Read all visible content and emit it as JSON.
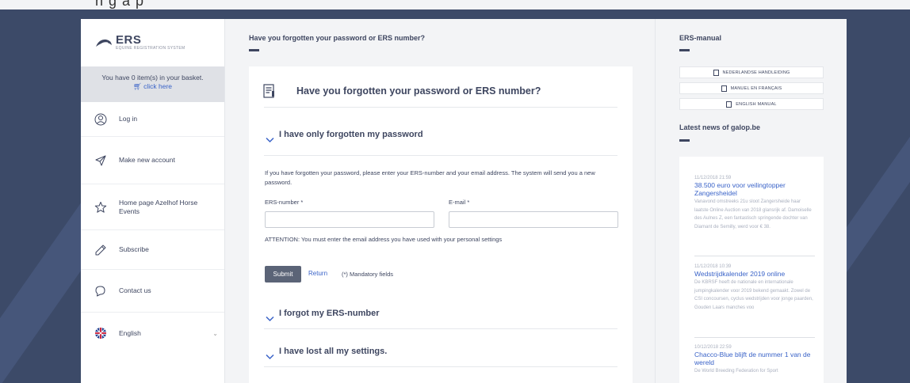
{
  "top_strip": {
    "partial_text": "n g  a   p"
  },
  "logo": {
    "title": "ERS",
    "subtitle": "EQUINE REGISTRATION SYSTEM"
  },
  "basket": {
    "message": "You have 0 item(s) in your basket.",
    "link": "click here"
  },
  "sidebar": {
    "items": [
      {
        "label": "Log in",
        "icon": "user-circle-icon"
      },
      {
        "label": "Make new account",
        "icon": "paper-plane-icon"
      },
      {
        "label": "Home page Azelhof Horse Events",
        "icon": "star-icon"
      },
      {
        "label": "Subscribe",
        "icon": "pencil-icon"
      },
      {
        "label": "Contact us",
        "icon": "chat-icon"
      },
      {
        "label": "English",
        "icon": "uk-flag-icon"
      }
    ]
  },
  "main": {
    "page_title": "Have you forgotten your password or ERS number?",
    "card_title": "Have you forgotten your password or ERS number?",
    "section_password": "I have only forgotten my password",
    "instruction": "If you have forgotten your password, please enter your ERS-number and your email address. The system will send you a new password.",
    "ers_label": "ERS-number *",
    "email_label": "E-mail *",
    "ers_value": "",
    "email_value": "",
    "attention": "ATTENTION: You must enter the email address you have used with your personal settings",
    "submit_label": "Submit",
    "return_label": "Return",
    "mandatory": "(*) Mandatory fields",
    "section_ers": "I forgot my ERS-number",
    "section_lost": "I have lost all my settings."
  },
  "right": {
    "manual_title": "ERS-manual",
    "manuals": [
      "NEDERLANDSE HANDLEIDING",
      "MANUEL EN FRANÇAIS",
      "ENGLISH MANUAL"
    ],
    "news_title": "Latest news of galop.be",
    "news": [
      {
        "date": "11/12/2018 21:59",
        "title": "38.500 euro voor veilingtopper Zangersheidel",
        "body": "Vanavond omstreeks 21u sloot Zangersheide haar laatste Online Auction van 2018 glansrijk af. Damoiselle des Aulnes Z, een fantastisch springende dochter van Diamant de Semilly, werd voor € 38."
      },
      {
        "date": "11/12/2018 10:39",
        "title": "Wedstrijdkalender 2019 online",
        "body": "De KBRSF heeft de nationale en internationale jumpingkalender voor 2019 bekend gemaakt.  Zowel de CSI concoursen, cyclus wedstrijden voor jonge paarden, Gouden Laars manches voo"
      },
      {
        "date": "10/12/2018 22:59",
        "title": "Chacco-Blue blijft de nummer 1 van de wereld",
        "body": "De World Breeding Federation for Sport"
      }
    ]
  },
  "colors": {
    "accent": "#3a63c8",
    "navy": "#3e4660",
    "background": "#3c4a68",
    "button": "#5b6477"
  }
}
